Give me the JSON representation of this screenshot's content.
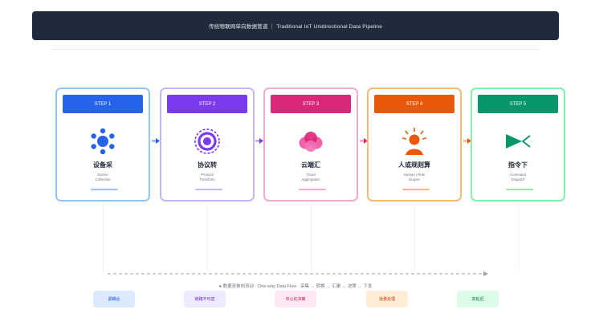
{
  "header": {
    "title": "传统物联网单向数据管道 ｜ Traditional IoT Unidirectional Data Pipeline"
  },
  "steps": [
    {
      "label": "STEP 1",
      "title": "设备采",
      "subtitle": "Device\nCollection",
      "color": "#2563eb",
      "border": "#93c5fd",
      "icon": "device-cluster-icon"
    },
    {
      "label": "STEP 2",
      "title": "协议转",
      "subtitle": "Protocol\nTransform",
      "color": "#7c3aed",
      "border": "#c4b5fd",
      "icon": "protocol-ring-icon"
    },
    {
      "label": "STEP 3",
      "title": "云端汇",
      "subtitle": "Cloud\nAggregation",
      "color": "#db2777",
      "border": "#f9a8d4",
      "icon": "cloud-cluster-icon"
    },
    {
      "label": "STEP 4",
      "title": "人或规则算",
      "subtitle": "Human / Rule\nEngine",
      "color": "#ea580c",
      "border": "#fdba74",
      "icon": "person-rule-icon"
    },
    {
      "label": "STEP 5",
      "title": "指令下",
      "subtitle": "Command\nDispatch",
      "color": "#059669",
      "border": "#86efac",
      "icon": "command-dispatch-icon"
    }
  ],
  "flow": {
    "caption": "●  数据流单向流动  ·  One-way Data Flow  ·  采集 → 转换 → 汇聚 → 决策 → 下发"
  },
  "tags": [
    {
      "text": "紧耦合",
      "bg": "#dbeafe",
      "fg": "#1d4ed8"
    },
    {
      "text": "链路不可逆",
      "bg": "#ede9fe",
      "fg": "#6d28d9"
    },
    {
      "text": "中心化决策",
      "bg": "#fce7f3",
      "fg": "#be185d"
    },
    {
      "text": "批量处理",
      "bg": "#ffedd5",
      "fg": "#c2410c"
    },
    {
      "text": "高延迟",
      "bg": "#dcfce7",
      "fg": "#047857"
    }
  ]
}
